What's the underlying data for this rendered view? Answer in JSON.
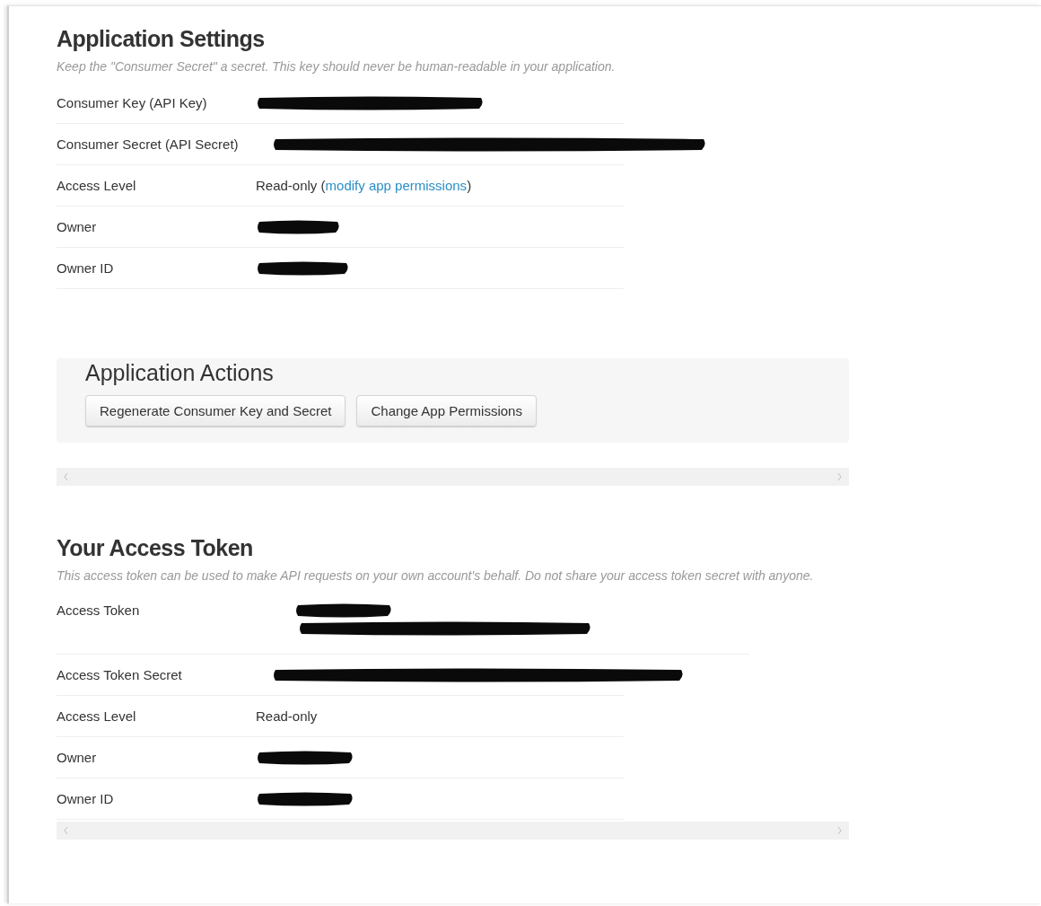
{
  "application_settings": {
    "title": "Application Settings",
    "description": "Keep the \"Consumer Secret\" a secret. This key should never be human-readable in your application.",
    "rows": [
      {
        "label": "Consumer Key (API Key)",
        "kind": "redacted"
      },
      {
        "label": "Consumer Secret (API Secret)",
        "kind": "redacted"
      },
      {
        "label": "Access Level",
        "kind": "text_link",
        "prefix": "Read-only (",
        "link": "modify app permissions",
        "suffix": ")"
      },
      {
        "label": "Owner",
        "kind": "redacted"
      },
      {
        "label": "Owner ID",
        "kind": "redacted"
      }
    ]
  },
  "application_actions": {
    "title": "Application Actions",
    "buttons": [
      "Regenerate Consumer Key and Secret",
      "Change App Permissions"
    ]
  },
  "access_token": {
    "title": "Your Access Token",
    "description": "This access token can be used to make API requests on your own account's behalf. Do not share your access token secret with anyone.",
    "rows": [
      {
        "label": "Access Token",
        "kind": "redacted_two_line"
      },
      {
        "label": "Access Token Secret",
        "kind": "redacted"
      },
      {
        "label": "Access Level",
        "kind": "text",
        "value": "Read-only"
      },
      {
        "label": "Owner",
        "kind": "redacted"
      },
      {
        "label": "Owner ID",
        "kind": "redacted"
      }
    ]
  }
}
